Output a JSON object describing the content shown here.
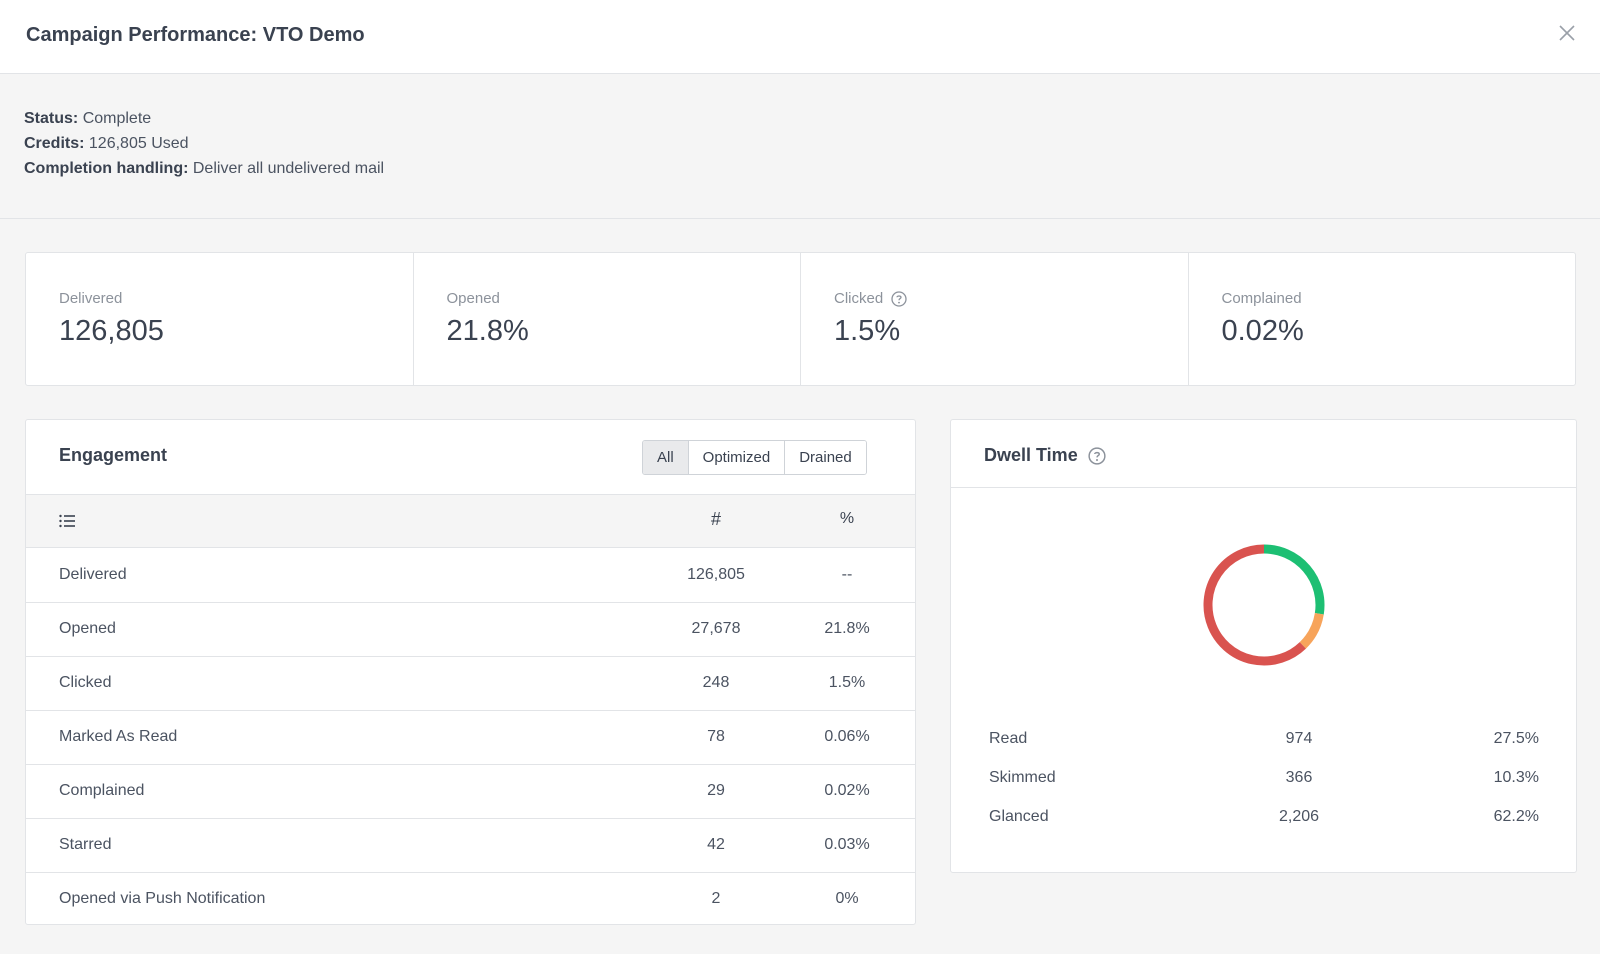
{
  "header": {
    "title": "Campaign Performance: VTO Demo",
    "close_icon": "close-icon"
  },
  "meta": {
    "status_label": "Status:",
    "status_value": "Complete",
    "credits_label": "Credits:",
    "credits_value": "126,805 Used",
    "completion_label": "Completion handling:",
    "completion_value": "Deliver all undelivered mail"
  },
  "stats": [
    {
      "label": "Delivered",
      "value": "126,805"
    },
    {
      "label": "Opened",
      "value": "21.8%"
    },
    {
      "label": "Clicked",
      "value": "1.5%"
    },
    {
      "label": "Complained",
      "value": "0.02%"
    }
  ],
  "engagement": {
    "title": "Engagement",
    "filters": [
      "All",
      "Optimized",
      "Drained"
    ],
    "active_filter": "All",
    "col_num": "#",
    "col_pct": "%",
    "rows": [
      {
        "name": "Delivered",
        "num": "126,805",
        "pct": "--"
      },
      {
        "name": "Opened",
        "num": "27,678",
        "pct": "21.8%"
      },
      {
        "name": "Clicked",
        "num": "248",
        "pct": "1.5%"
      },
      {
        "name": "Marked As Read",
        "num": "78",
        "pct": "0.06%"
      },
      {
        "name": "Complained",
        "num": "29",
        "pct": "0.02%"
      },
      {
        "name": "Starred",
        "num": "42",
        "pct": "0.03%"
      },
      {
        "name": "Opened via Push Notification",
        "num": "2",
        "pct": "0%"
      }
    ]
  },
  "dwell": {
    "title": "Dwell Time",
    "rows": [
      {
        "name": "Read",
        "num": "974",
        "pct": "27.5%",
        "share": 27.5,
        "color": "#1dbf73"
      },
      {
        "name": "Skimmed",
        "num": "366",
        "pct": "10.3%",
        "share": 10.3,
        "color": "#f7a45b"
      },
      {
        "name": "Glanced",
        "num": "2,206",
        "pct": "62.2%",
        "share": 62.2,
        "color": "#d9534f"
      }
    ]
  }
}
